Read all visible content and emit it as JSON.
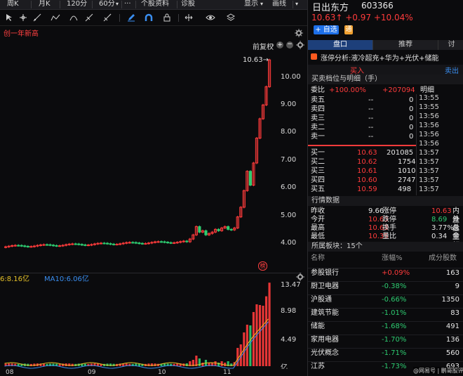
{
  "toolbar": {
    "items": [
      "周K",
      "月K",
      "120分",
      "60分",
      "···",
      "个股资料",
      "诊股",
      "显示",
      "画线"
    ],
    "chevron": "▾"
  },
  "chart": {
    "badge": "创一年新高",
    "adjust_label": "前复权",
    "price_ticks": [
      "10.00",
      "9.00",
      "8.00",
      "7.00",
      "6.00",
      "5.00",
      "4.00"
    ],
    "high_label": "10.63→",
    "volume_legend_1": "6:8.16亿",
    "volume_legend_2": "MA10:6.06亿",
    "volume_ticks": [
      "13.47",
      "8.98",
      "4.49",
      "亿"
    ],
    "x_labels": [
      "08",
      "09",
      "10",
      "11"
    ],
    "marker": "榜",
    "colors": {
      "up": "#ff3b3b",
      "down": "#2ecc71",
      "ma_yellow": "#e6c229",
      "ma_blue": "#3a8ef0",
      "ma_white": "#e0e0e0"
    }
  },
  "stock": {
    "name": "日出东方",
    "code": "603366",
    "price": "10.63",
    "arrow": "↑",
    "change": "+0.97",
    "change_pct": "+10.04%",
    "add_watch": "+ 自选",
    "badge": "通"
  },
  "tabs": [
    "盘口",
    "推荐",
    "讨"
  ],
  "limit_analysis": {
    "label": "涨停分析:",
    "text": "液冷超充+华为+光伏+储能"
  },
  "buy_sell": {
    "buy": "买入",
    "sell": "卖出"
  },
  "orderbook": {
    "title": "买卖档位与明细（手）",
    "weibi_label": "委比",
    "weibi_pct": "+100.00%",
    "weibi_num": "+207094",
    "detail_label": "明细",
    "sells": [
      {
        "label": "卖五",
        "price": "--",
        "vol": "0"
      },
      {
        "label": "卖四",
        "price": "--",
        "vol": "0"
      },
      {
        "label": "卖三",
        "price": "--",
        "vol": "0"
      },
      {
        "label": "卖二",
        "price": "--",
        "vol": "0"
      },
      {
        "label": "卖一",
        "price": "--",
        "vol": "0"
      }
    ],
    "buys": [
      {
        "label": "买一",
        "price": "10.63",
        "vol": "201085"
      },
      {
        "label": "买二",
        "price": "10.62",
        "vol": "1754"
      },
      {
        "label": "买三",
        "price": "10.61",
        "vol": "1010"
      },
      {
        "label": "买四",
        "price": "10.60",
        "vol": "2747"
      },
      {
        "label": "买五",
        "price": "10.59",
        "vol": "498"
      }
    ],
    "times": [
      "13:55",
      "13:55",
      "13:56",
      "13:56",
      "13:56",
      "13:56",
      "13:57",
      "13:57",
      "13:57",
      "13:57",
      "13:57"
    ]
  },
  "quote": {
    "title": "行情数据",
    "rows": [
      [
        {
          "k": "昨收",
          "v": "9.66",
          "c": "white"
        },
        {
          "k": "涨停",
          "v": "10.63",
          "c": "red"
        },
        {
          "k": "内盘",
          "v": "",
          "c": "white"
        }
      ],
      [
        {
          "k": "今开",
          "v": "10.63",
          "c": "red"
        },
        {
          "k": "跌停",
          "v": "8.69",
          "c": "green"
        },
        {
          "k": "外盘",
          "v": "",
          "c": "white"
        }
      ],
      [
        {
          "k": "最高",
          "v": "10.63",
          "c": "red"
        },
        {
          "k": "换手",
          "v": "3.77%",
          "c": "white"
        },
        {
          "k": "总量",
          "v": "",
          "c": "white"
        }
      ],
      [
        {
          "k": "最低",
          "v": "10.35",
          "c": "red"
        },
        {
          "k": "量比",
          "v": "0.34",
          "c": "white"
        },
        {
          "k": "金额",
          "v": "",
          "c": "white"
        }
      ]
    ]
  },
  "sectors": {
    "title": "所属板块：15个",
    "headers": [
      "名称",
      "涨幅%",
      "成分股数"
    ],
    "items": [
      {
        "name": "参股银行",
        "pct": "+0.09%",
        "count": "163",
        "c": "red"
      },
      {
        "name": "厨卫电器",
        "pct": "-0.38%",
        "count": "9",
        "c": "green"
      },
      {
        "name": "沪股通",
        "pct": "-0.66%",
        "count": "1350",
        "c": "green"
      },
      {
        "name": "建筑节能",
        "pct": "-1.01%",
        "count": "83",
        "c": "green"
      },
      {
        "name": "储能",
        "pct": "-1.68%",
        "count": "491",
        "c": "green"
      },
      {
        "name": "家用电器",
        "pct": "-1.70%",
        "count": "136",
        "c": "green"
      },
      {
        "name": "光伏概念",
        "pct": "-1.71%",
        "count": "560",
        "c": "green"
      },
      {
        "name": "江苏",
        "pct": "-1.73%",
        "count": "693",
        "c": "green"
      }
    ]
  },
  "watermark": "@网易号 | 鹏哥股评"
}
